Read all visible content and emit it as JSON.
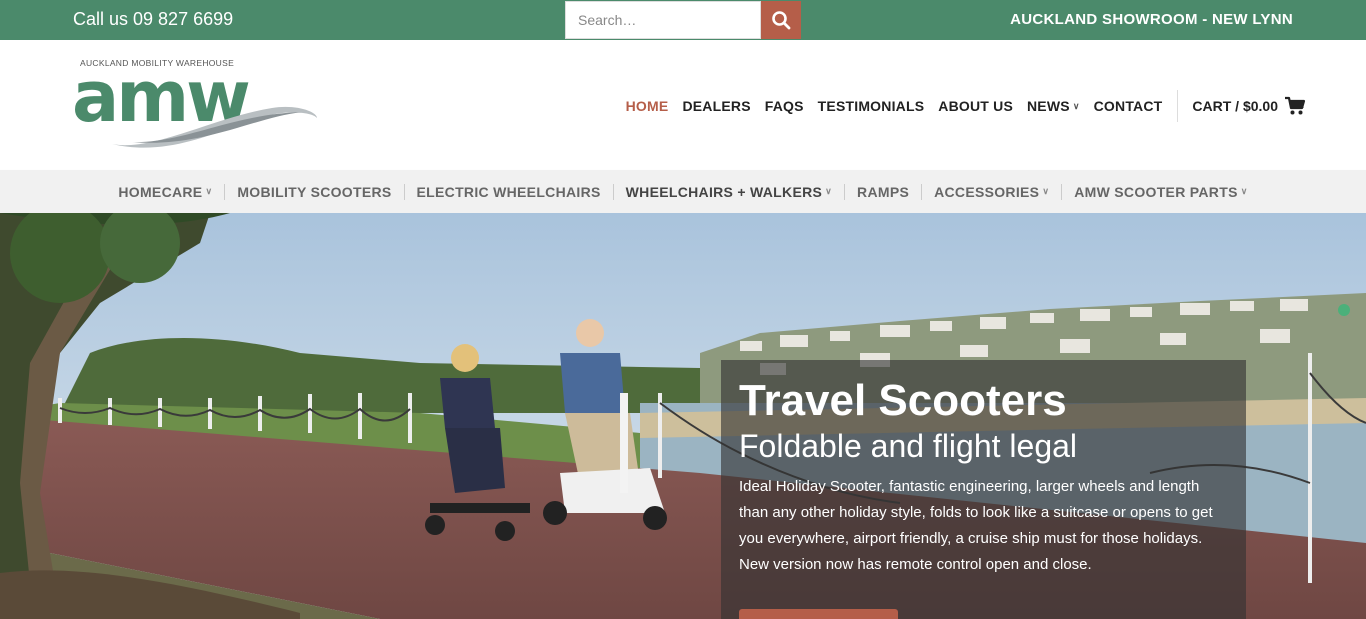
{
  "topbar": {
    "phone": "Call us 09 827 6699",
    "search_placeholder": "Search…",
    "showroom": "AUCKLAND SHOWROOM - NEW LYNN"
  },
  "logo": {
    "tagline": "AUCKLAND MOBILITY WAREHOUSE",
    "mark": "amw"
  },
  "mainnav": {
    "items": [
      {
        "label": "HOME",
        "active": true
      },
      {
        "label": "DEALERS"
      },
      {
        "label": "FAQS"
      },
      {
        "label": "TESTIMONIALS"
      },
      {
        "label": "ABOUT US"
      },
      {
        "label": "NEWS",
        "dropdown": true
      },
      {
        "label": "CONTACT"
      }
    ],
    "cart": "CART / $0.00"
  },
  "subnav": {
    "items": [
      {
        "label": "HOMECARE",
        "dropdown": true
      },
      {
        "label": "MOBILITY SCOOTERS"
      },
      {
        "label": "ELECTRIC WHEELCHAIRS"
      },
      {
        "label": "WHEELCHAIRS + WALKERS",
        "dropdown": true
      },
      {
        "label": "RAMPS"
      },
      {
        "label": "ACCESSORIES",
        "dropdown": true
      },
      {
        "label": "AMW SCOOTER PARTS",
        "dropdown": true
      }
    ]
  },
  "hero": {
    "title": "Travel Scooters",
    "subtitle": "Foldable and flight legal",
    "body": "Ideal Holiday Scooter, fantastic engineering, larger wheels and length than any other holiday style, folds to look like a suitcase or opens to get you everywhere, airport friendly, a cruise ship must for those holidays. New version now has remote control open and close."
  },
  "colors": {
    "brand_green": "#4b8a6b",
    "accent": "#b55e49"
  }
}
